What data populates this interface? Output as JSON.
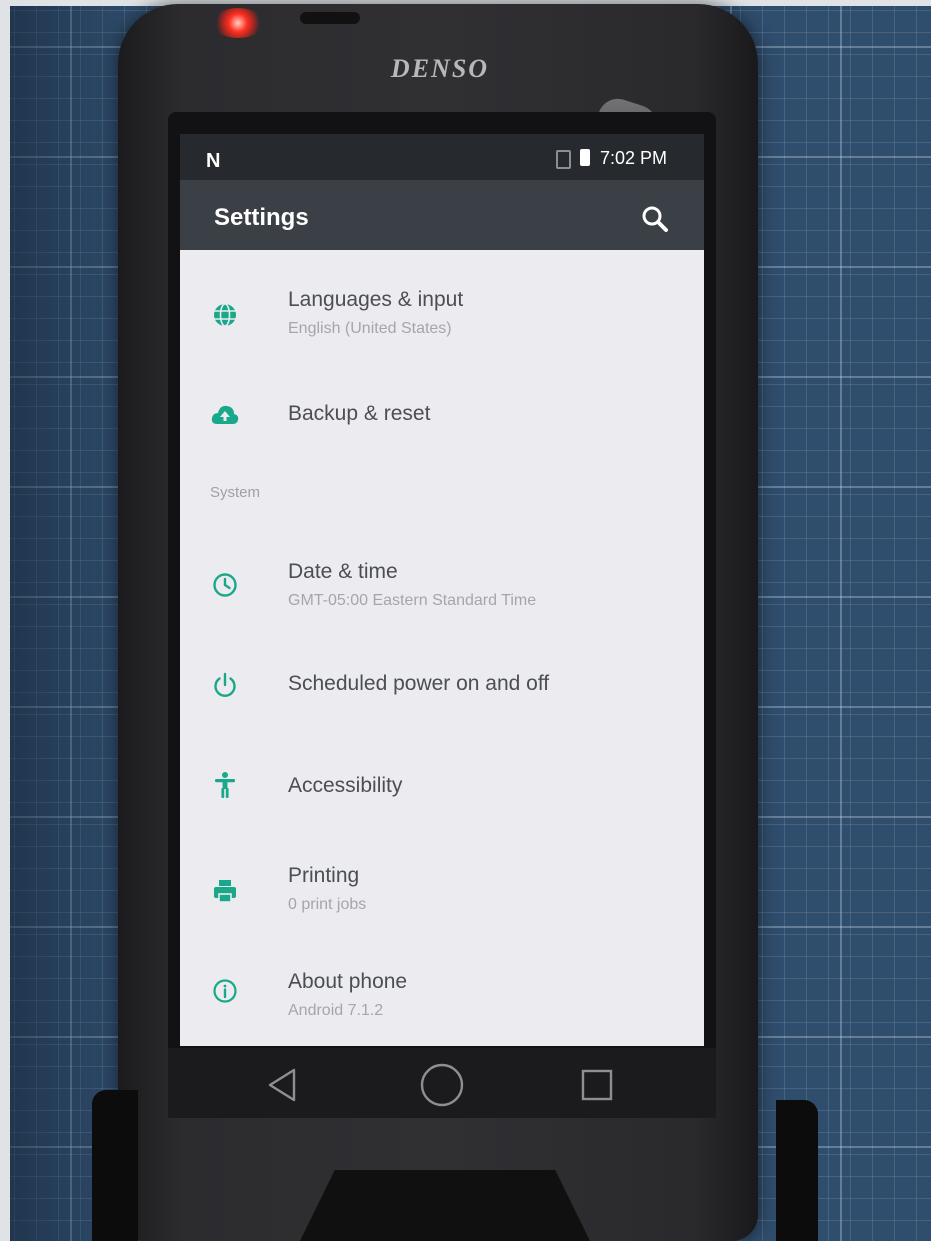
{
  "device": {
    "brand": "DENSO"
  },
  "status_bar": {
    "left_icon": "N",
    "time": "7:02 PM"
  },
  "app_bar": {
    "title": "Settings",
    "search_icon": "search-icon"
  },
  "settings": {
    "items_top": [
      {
        "title": "Languages & input",
        "subtitle": "English (United States)",
        "icon": "globe-icon"
      },
      {
        "title": "Backup & reset",
        "subtitle": "",
        "icon": "cloud-upload-icon"
      }
    ],
    "section_label": "System",
    "items_system": [
      {
        "title": "Date & time",
        "subtitle": "GMT-05:00 Eastern Standard Time",
        "icon": "clock-icon"
      },
      {
        "title": "Scheduled power on and off",
        "subtitle": "",
        "icon": "power-icon"
      },
      {
        "title": "Accessibility",
        "subtitle": "",
        "icon": "accessibility-icon"
      },
      {
        "title": "Printing",
        "subtitle": "0 print jobs",
        "icon": "printer-icon"
      },
      {
        "title": "About phone",
        "subtitle": "Android 7.1.2",
        "icon": "info-icon"
      }
    ]
  },
  "nav_bar": {
    "back": "back-icon",
    "home": "home-icon",
    "recents": "recents-icon"
  },
  "colors": {
    "accent": "#1aa88a",
    "app_bar": "#3b4046",
    "status_bar": "#262a2e",
    "screen_bg": "#ecebef"
  }
}
